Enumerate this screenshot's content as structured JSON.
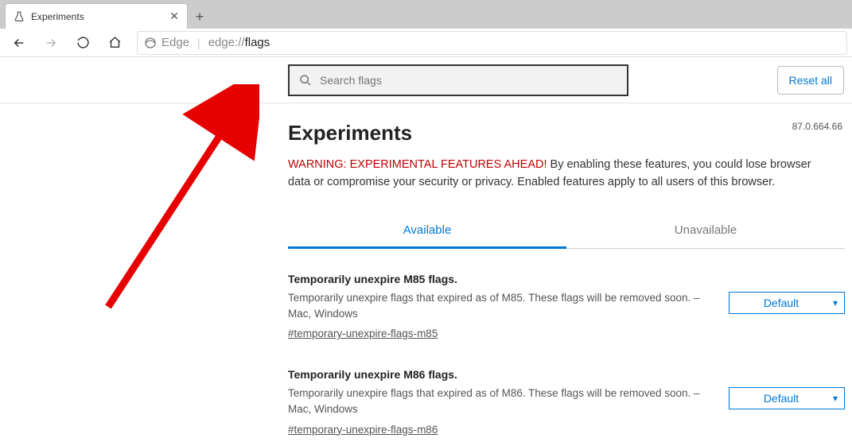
{
  "tab": {
    "title": "Experiments"
  },
  "addressbar": {
    "brand": "Edge",
    "protocol": "edge://",
    "path": "flags"
  },
  "header": {
    "search_placeholder": "Search flags",
    "reset_label": "Reset all"
  },
  "page": {
    "title": "Experiments",
    "version": "87.0.664.66",
    "warning_prefix": "WARNING: EXPERIMENTAL FEATURES AHEAD!",
    "warning_text": "By enabling these features, you could lose browser data or compromise your security or privacy. Enabled features apply to all users of this browser."
  },
  "tabs": {
    "available": "Available",
    "unavailable": "Unavailable"
  },
  "flags": [
    {
      "title": "Temporarily unexpire M85 flags.",
      "desc": "Temporarily unexpire flags that expired as of M85. These flags will be removed soon. – Mac, Windows",
      "hash": "#temporary-unexpire-flags-m85",
      "select": "Default"
    },
    {
      "title": "Temporarily unexpire M86 flags.",
      "desc": "Temporarily unexpire flags that expired as of M86. These flags will be removed soon. – Mac, Windows",
      "hash": "#temporary-unexpire-flags-m86",
      "select": "Default"
    }
  ]
}
